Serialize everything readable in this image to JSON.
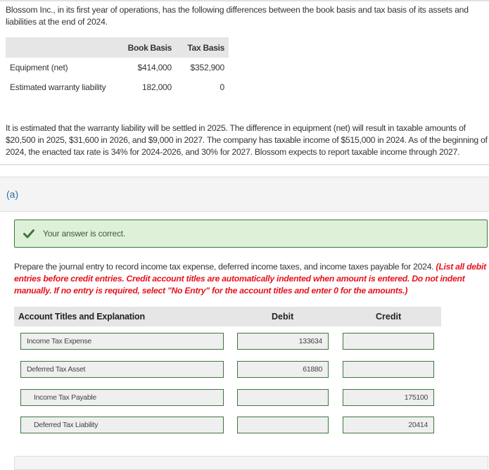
{
  "problem": {
    "intro": "Blossom Inc., in its first year of operations, has the following differences between the book basis and tax basis of its assets and liabilities at the end of 2024.",
    "basis_table": {
      "headers": [
        "",
        "Book Basis",
        "Tax Basis"
      ],
      "rows": [
        {
          "label": "Equipment (net)",
          "book": "$414,000",
          "tax": "$352,900"
        },
        {
          "label": "Estimated warranty liability",
          "book": "182,000",
          "tax": "0"
        }
      ]
    },
    "narrative": "It is estimated that the warranty liability will be settled in 2025. The difference in equipment (net) will result in taxable amounts of $20,500 in 2025, $31,600 in 2026, and $9,000 in 2027. The company has taxable income of $515,000 in 2024. As of the beginning of 2024, the enacted tax rate is 34% for 2024-2026, and 30% for 2027. Blossom expects to report taxable income through 2027."
  },
  "part": {
    "label": "(a)",
    "feedback": {
      "icon": "check-icon",
      "text": "Your answer is correct.",
      "color": "#3c763d"
    },
    "instructions": "Prepare the journal entry to record income tax expense, deferred income taxes, and income taxes payable for 2024.",
    "instructions_note": "(List all debit entries before credit entries. Credit account titles are automatically indented when amount is entered. Do not indent manually. If no entry is required, select \"No Entry\" for the account titles and enter 0 for the amounts.)",
    "journal": {
      "headers": {
        "account": "Account Titles and Explanation",
        "debit": "Debit",
        "credit": "Credit"
      },
      "rows": [
        {
          "account": "Income Tax Expense",
          "debit": "133634",
          "credit": ""
        },
        {
          "account": "Deferred Tax Asset",
          "debit": "61880",
          "credit": ""
        },
        {
          "account": "Income Tax Payable",
          "debit": "",
          "credit": "175100"
        },
        {
          "account": "Deferred Tax Liability",
          "debit": "",
          "credit": "20414"
        }
      ]
    }
  },
  "colors": {
    "correct_border": "#3c763d",
    "correct_bg": "#dff0d8",
    "note_red": "#e8111b",
    "part_label_blue": "#2a6ea6"
  }
}
